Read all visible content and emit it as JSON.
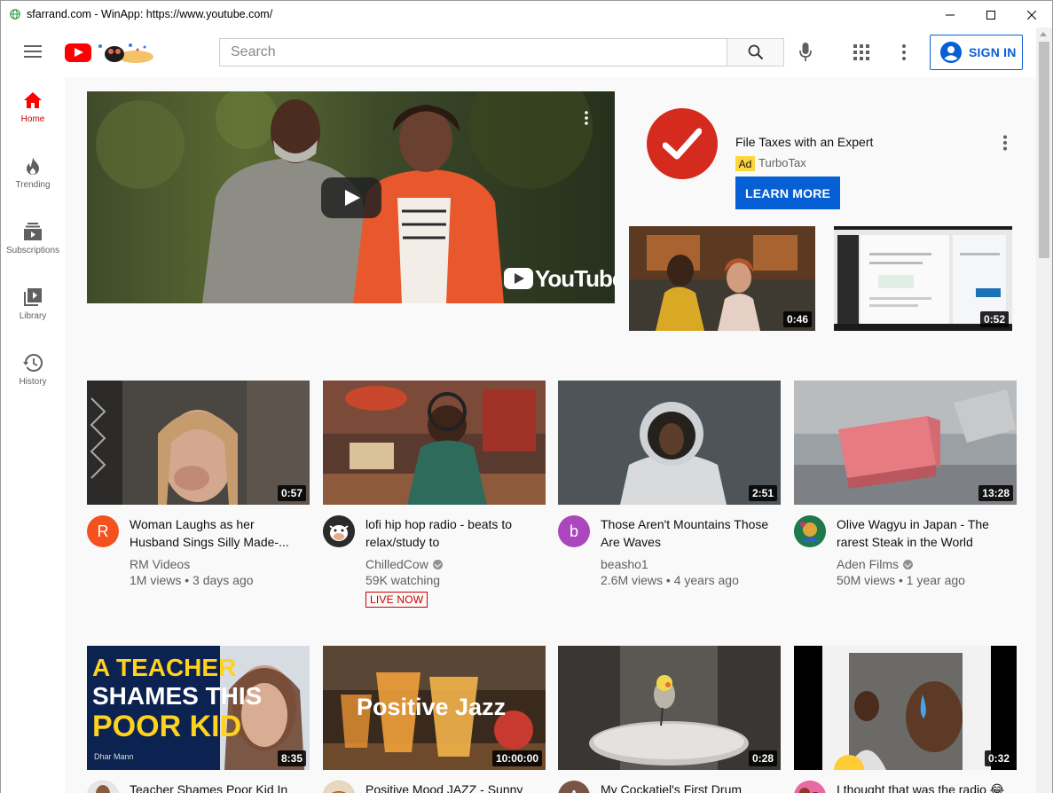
{
  "window": {
    "title": "sfarrand.com - WinApp:  https://www.youtube.com/"
  },
  "masthead": {
    "search_placeholder": "Search",
    "signin_label": "SIGN IN"
  },
  "sidebar": {
    "items": [
      {
        "label": "Home",
        "icon": "home-icon",
        "active": true
      },
      {
        "label": "Trending",
        "icon": "flame-icon",
        "active": false
      },
      {
        "label": "Subscriptions",
        "icon": "subscriptions-icon",
        "active": false
      },
      {
        "label": "Library",
        "icon": "library-icon",
        "active": false
      },
      {
        "label": "History",
        "icon": "history-icon",
        "active": false
      }
    ]
  },
  "ad": {
    "title": "File Taxes with an Expert",
    "badge": "Ad",
    "advertiser": "TurboTax",
    "button": "LEARN MORE",
    "thumb1_duration": "0:46",
    "thumb2_duration": "0:52",
    "hero_watermark": "YouTube"
  },
  "videos": [
    {
      "title": "Woman Laughs as her Husband Sings Silly Made-...",
      "channel": "RM Videos",
      "verified": false,
      "stats": "1M views • 3 days ago",
      "duration": "0:57",
      "avatar_letter": "R",
      "avatar_color": "#f4511e"
    },
    {
      "title": "lofi hip hop radio - beats to relax/study to",
      "channel": "ChilledCow",
      "verified": true,
      "stats": "59K watching",
      "duration": "",
      "live_label": "LIVE NOW",
      "avatar_letter": "",
      "avatar_color": "#2b2b2b"
    },
    {
      "title": "Those Aren't Mountains Those Are Waves",
      "channel": "beasho1",
      "verified": false,
      "stats": "2.6M views • 4 years ago",
      "duration": "2:51",
      "avatar_letter": "b",
      "avatar_color": "#ab47bc"
    },
    {
      "title": "Olive Wagyu in Japan - The rarest Steak in the World",
      "channel": "Aden Films",
      "verified": true,
      "stats": "50M views • 1 year ago",
      "duration": "13:28",
      "avatar_letter": "",
      "avatar_color": "#1e7a4a"
    },
    {
      "title": "Teacher Shames Poor Kid In Class, Instantly Regrets It |...",
      "channel": "",
      "verified": false,
      "stats": "",
      "duration": "8:35",
      "avatar_letter": "",
      "avatar_color": "#6d4c41"
    },
    {
      "title": "Positive Mood JAZZ - Sunny Jazz Cafe and Bossa Nova...",
      "channel": "",
      "verified": false,
      "stats": "",
      "duration": "10:00:00",
      "avatar_letter": "",
      "avatar_color": "#8d5a2b"
    },
    {
      "title": "My Cockatiel's First Drum Lesson",
      "channel": "",
      "verified": false,
      "stats": "",
      "duration": "0:28",
      "avatar_letter": "A",
      "avatar_color": "#795548"
    },
    {
      "title": "I thought that was the radio 😂",
      "channel": "",
      "verified": false,
      "stats": "",
      "duration": "0:32",
      "avatar_letter": "",
      "avatar_color": "#c2185b"
    }
  ],
  "thumb_text": {
    "teacher_lines": [
      "A TEACHER",
      "SHAMES THIS",
      "POOR KID"
    ],
    "teacher_brand": "Dhar Mann",
    "jazz": "Positive Jazz"
  },
  "colors": {
    "brand_red": "#ff0000",
    "accent_blue": "#065fd4",
    "ad_badge": "#fcd73b",
    "active_red": "#cc0000"
  }
}
